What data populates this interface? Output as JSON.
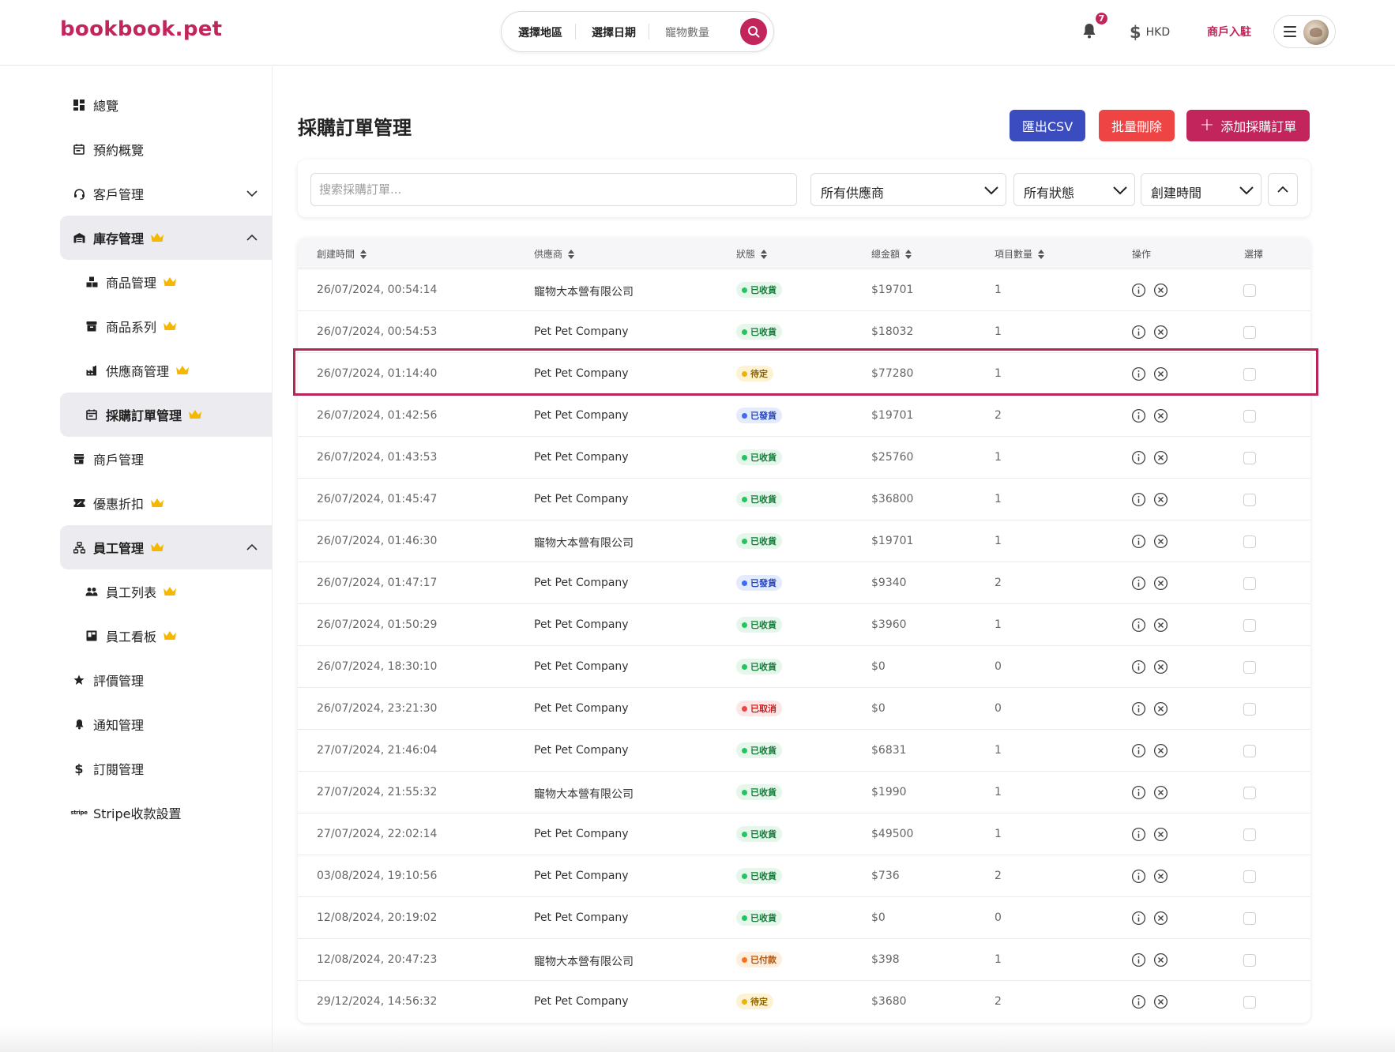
{
  "header": {
    "logo": "bookbook.pet",
    "search": {
      "region": "選擇地區",
      "date": "選擇日期",
      "pets": "寵物數量"
    },
    "notifications_count": "7",
    "currency": "HKD",
    "merchant_link": "商戶入駐"
  },
  "sidebar": {
    "items": [
      {
        "label": "總覽",
        "icon": "dashboard-icon"
      },
      {
        "label": "預約概覽",
        "icon": "calendar-icon"
      },
      {
        "label": "客戶管理",
        "icon": "headset-icon"
      },
      {
        "label": "庫存管理",
        "icon": "warehouse-icon"
      },
      {
        "label": "商品管理",
        "icon": "boxes-icon"
      },
      {
        "label": "商品系列",
        "icon": "archive-icon"
      },
      {
        "label": "供應商管理",
        "icon": "factory-icon"
      },
      {
        "label": "採購訂單管理",
        "icon": "calendar-icon"
      },
      {
        "label": "商戶管理",
        "icon": "store-icon"
      },
      {
        "label": "優惠折扣",
        "icon": "ticket-icon"
      },
      {
        "label": "員工管理",
        "icon": "org-chart-icon"
      },
      {
        "label": "員工列表",
        "icon": "people-icon"
      },
      {
        "label": "員工看板",
        "icon": "board-icon"
      },
      {
        "label": "評價管理",
        "icon": "star-icon"
      },
      {
        "label": "通知管理",
        "icon": "bell-icon"
      },
      {
        "label": "訂閱管理",
        "icon": "dollar-icon"
      },
      {
        "label": "Stripe收款設置",
        "icon": "stripe-icon"
      }
    ]
  },
  "main": {
    "title": "採購訂單管理",
    "buttons": {
      "export": "匯出CSV",
      "bulk_delete": "批量刪除",
      "add": "添加採購訂單"
    },
    "filters": {
      "search_placeholder": "搜索採購訂單...",
      "supplier": "所有供應商",
      "status": "所有狀態",
      "sort": "創建時間"
    },
    "table": {
      "columns": [
        "創建時間",
        "供應商",
        "狀態",
        "總金額",
        "項目數量",
        "操作",
        "選擇"
      ],
      "rows": [
        {
          "created": "26/07/2024, 00:54:14",
          "supplier": "寵物大本營有限公司",
          "status": "已收貨",
          "total": "$19701",
          "qty": "1"
        },
        {
          "created": "26/07/2024, 00:54:53",
          "supplier": "Pet Pet Company",
          "status": "已收貨",
          "total": "$18032",
          "qty": "1"
        },
        {
          "created": "26/07/2024, 01:14:40",
          "supplier": "Pet Pet Company",
          "status": "待定",
          "total": "$77280",
          "qty": "1"
        },
        {
          "created": "26/07/2024, 01:42:56",
          "supplier": "Pet Pet Company",
          "status": "已發貨",
          "total": "$19701",
          "qty": "2"
        },
        {
          "created": "26/07/2024, 01:43:53",
          "supplier": "Pet Pet Company",
          "status": "已收貨",
          "total": "$25760",
          "qty": "1"
        },
        {
          "created": "26/07/2024, 01:45:47",
          "supplier": "Pet Pet Company",
          "status": "已收貨",
          "total": "$36800",
          "qty": "1"
        },
        {
          "created": "26/07/2024, 01:46:30",
          "supplier": "寵物大本營有限公司",
          "status": "已收貨",
          "total": "$19701",
          "qty": "1"
        },
        {
          "created": "26/07/2024, 01:47:17",
          "supplier": "Pet Pet Company",
          "status": "已發貨",
          "total": "$9340",
          "qty": "2"
        },
        {
          "created": "26/07/2024, 01:50:29",
          "supplier": "Pet Pet Company",
          "status": "已收貨",
          "total": "$3960",
          "qty": "1"
        },
        {
          "created": "26/07/2024, 18:30:10",
          "supplier": "Pet Pet Company",
          "status": "已收貨",
          "total": "$0",
          "qty": "0"
        },
        {
          "created": "26/07/2024, 23:21:30",
          "supplier": "Pet Pet Company",
          "status": "已取消",
          "total": "$0",
          "qty": "0"
        },
        {
          "created": "27/07/2024, 21:46:04",
          "supplier": "Pet Pet Company",
          "status": "已收貨",
          "total": "$6831",
          "qty": "1"
        },
        {
          "created": "27/07/2024, 21:55:32",
          "supplier": "寵物大本營有限公司",
          "status": "已收貨",
          "total": "$1990",
          "qty": "1"
        },
        {
          "created": "27/07/2024, 22:02:14",
          "supplier": "Pet Pet Company",
          "status": "已收貨",
          "total": "$49500",
          "qty": "1"
        },
        {
          "created": "03/08/2024, 19:10:56",
          "supplier": "Pet Pet Company",
          "status": "已收貨",
          "total": "$736",
          "qty": "2"
        },
        {
          "created": "12/08/2024, 20:19:02",
          "supplier": "Pet Pet Company",
          "status": "已收貨",
          "total": "$0",
          "qty": "0"
        },
        {
          "created": "12/08/2024, 20:47:23",
          "supplier": "寵物大本營有限公司",
          "status": "已付款",
          "total": "$398",
          "qty": "1"
        },
        {
          "created": "29/12/2024, 14:56:32",
          "supplier": "Pet Pet Company",
          "status": "待定",
          "total": "$3680",
          "qty": "2"
        }
      ]
    }
  },
  "colors": {
    "brand": "#c2255c",
    "export_button": "#3b4cc0",
    "delete_button": "#ef4444",
    "status_received": "#22c55e",
    "status_pending": "#eab308",
    "status_shipped": "#3b6ef5",
    "status_cancelled": "#ef4444",
    "status_paid": "#f97316"
  }
}
